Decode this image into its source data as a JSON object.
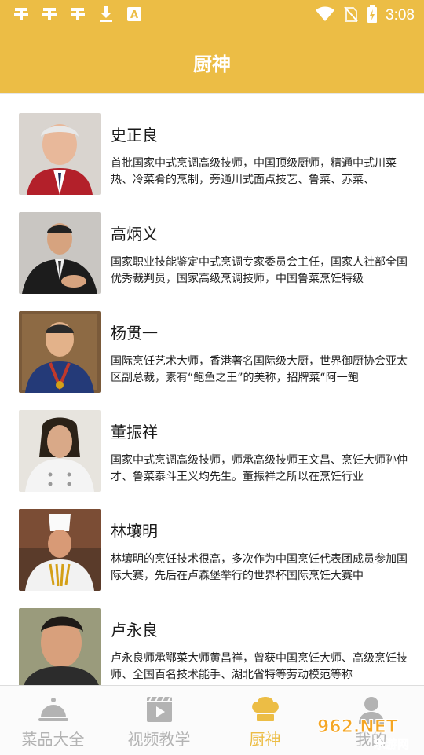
{
  "status_bar": {
    "time": "3:08",
    "left_icons": [
      "ghost-icon",
      "ghost-icon",
      "ghost-icon",
      "download-icon",
      "a-notification-icon"
    ],
    "right_icons": [
      "wifi-icon",
      "no-sim-icon",
      "battery-charging-icon"
    ]
  },
  "header": {
    "title": "厨神"
  },
  "chefs": [
    {
      "name": "史正良",
      "description": "首批国家中式烹调高级技师，中国顶级厨师，精通中式川菜热、冷菜肴的烹制，旁通川式面点技艺、鲁菜、苏菜、"
    },
    {
      "name": "高炳义",
      "description": "国家职业技能鉴定中式烹调专家委员会主任，国家人社部全国优秀裁判员，国家高级烹调技师，中国鲁菜烹饪特级"
    },
    {
      "name": "杨贯一",
      "description": "国际烹饪艺术大师，香港著名国际级大厨，世界御厨协会亚太区副总裁，素有“鲍鱼之王”的美称，招牌菜“阿一鲍"
    },
    {
      "name": "董振祥",
      "description": "国家中式烹调高级技师，师承高级技师王文昌、烹饪大师孙仲才、鲁菜泰斗王义均先生。董振祥之所以在烹饪行业"
    },
    {
      "name": "林壤明",
      "description": "林壤明的烹饪技术很高，多次作为中国烹饪代表团成员参加国际大赛，先后在卢森堡举行的世界杯国际烹饪大赛中"
    },
    {
      "name": "卢永良",
      "description": "卢永良师承鄂菜大师黄昌祥，曾获中国烹饪大师、高级烹饪技师、全国百名技术能手、湖北省特等劳动模范等称"
    }
  ],
  "tabs": [
    {
      "label": "菜品大全",
      "icon": "cloche-icon",
      "active": false
    },
    {
      "label": "视频教学",
      "icon": "video-icon",
      "active": false
    },
    {
      "label": "厨神",
      "icon": "chef-hat-icon",
      "active": true
    },
    {
      "label": "我的",
      "icon": "person-icon",
      "active": false
    }
  ],
  "watermark": {
    "text": "962.NET",
    "subtext": "乐游网"
  },
  "colors": {
    "accent": "#ecbd45",
    "inactive": "#b3b3b3",
    "text": "#222222"
  }
}
